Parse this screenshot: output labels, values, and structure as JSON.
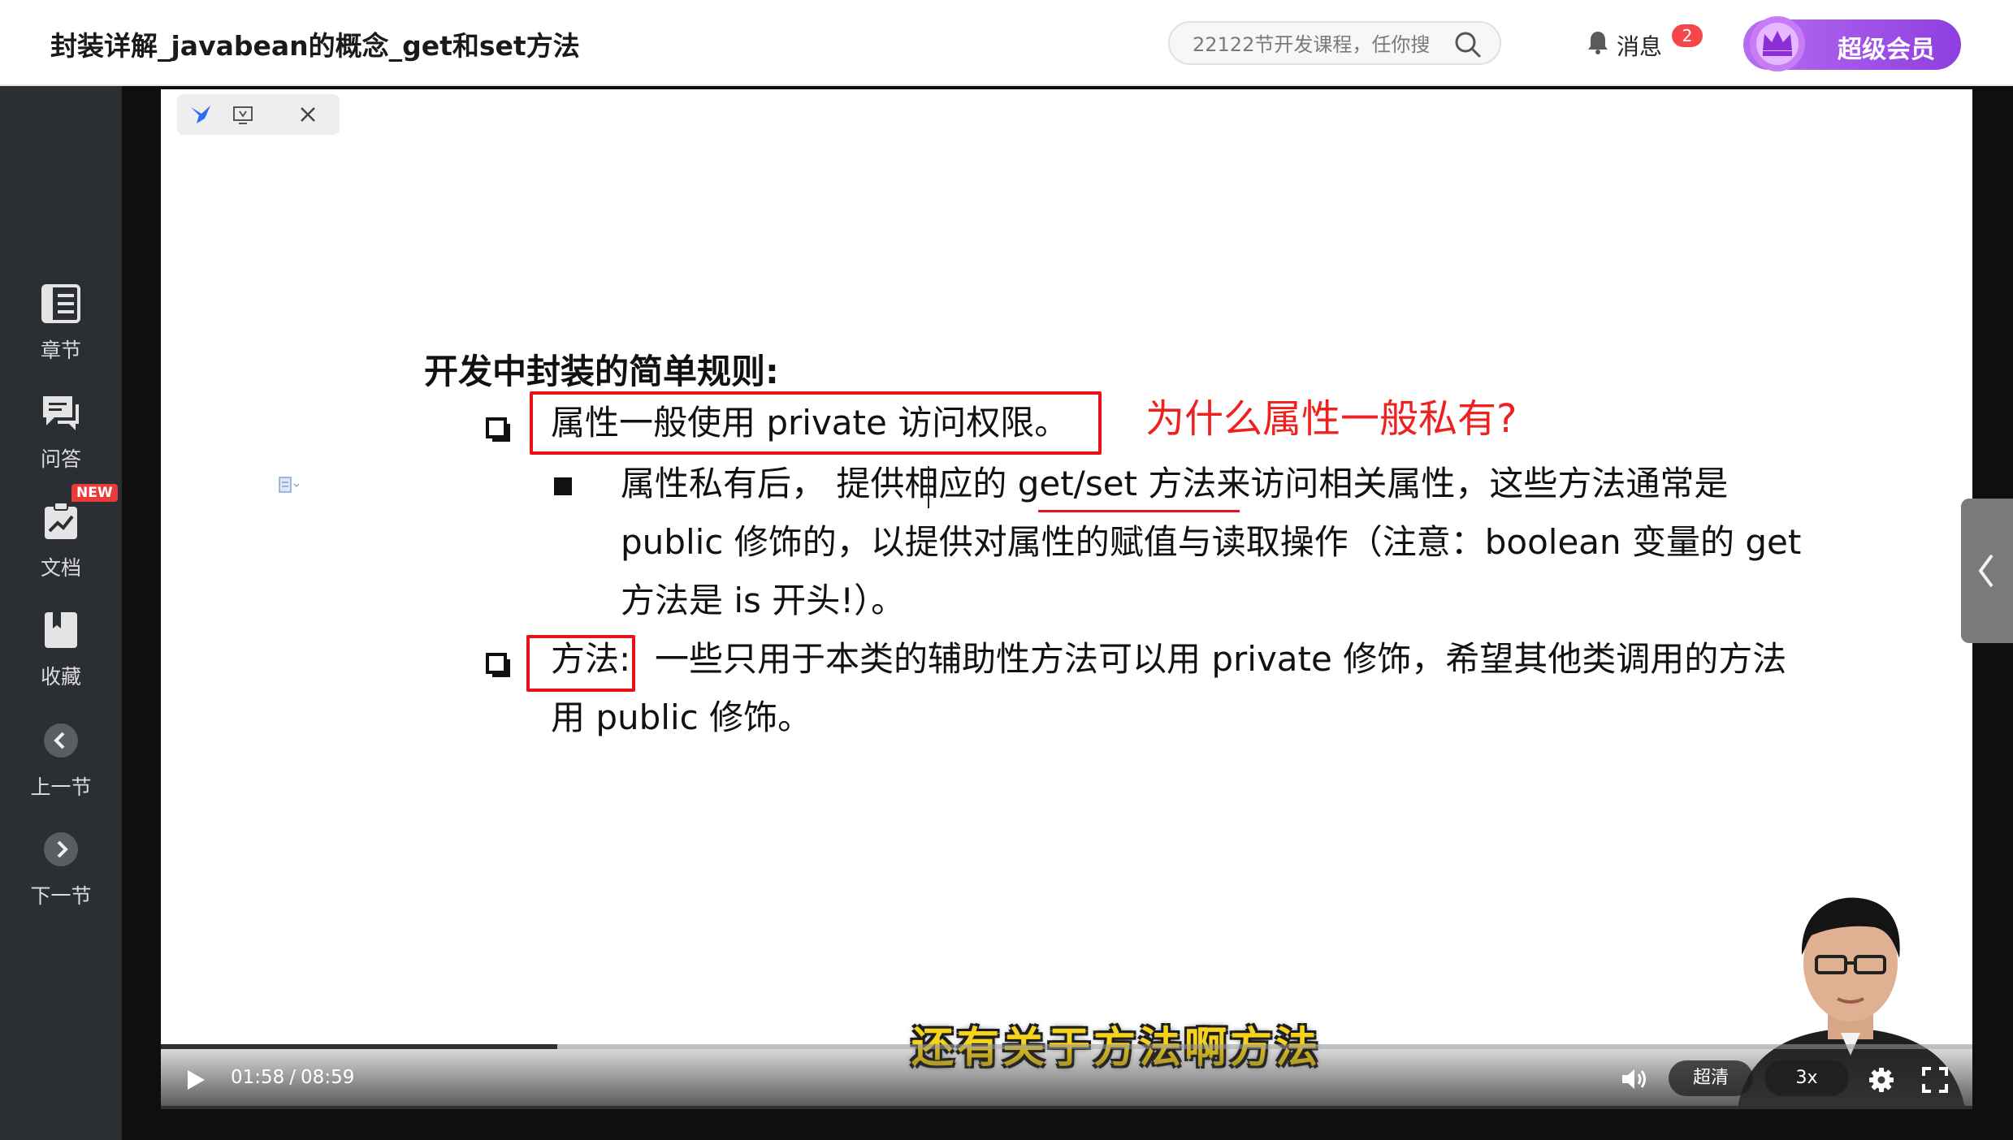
{
  "header": {
    "title": "封装详解_javabean的概念_get和set方法",
    "search_placeholder": "22122节开发课程，任你搜",
    "messages_label": "消息",
    "messages_count": "2",
    "vip_label": "超级会员"
  },
  "sidebar": {
    "items": [
      {
        "label": "章节",
        "icon": "chapters-icon"
      },
      {
        "label": "问答",
        "icon": "qa-icon"
      },
      {
        "label": "文档",
        "icon": "document-icon",
        "badge": "NEW"
      },
      {
        "label": "收藏",
        "icon": "bookmark-icon"
      },
      {
        "label": "上一节",
        "icon": "chevron-left-icon"
      },
      {
        "label": "下一节",
        "icon": "chevron-right-icon"
      }
    ]
  },
  "slide": {
    "heading": "开发中封装的简单规则:",
    "bullet1": "属性一般使用 private 访问权限。",
    "note": "为什么属性一般私有?",
    "sub1_line1": "属性私有后， 提供相应的 get/set 方法来访问相关属性，这些方法通常是",
    "sub1_line2": "public 修饰的，以提供对属性的赋值与读取操作（注意：boolean 变量的 get",
    "sub1_line3": "方法是 is 开头!）。",
    "bullet2_label": "方法:",
    "bullet2_rest": "一些只用于本类的辅助性方法可以用 private 修饰，希望其他类调用的方法",
    "bullet2_line2": "用 public 修饰。"
  },
  "player": {
    "subtitle": "还有关于方法啊方法",
    "current_time": "01:58",
    "time_separator": "/",
    "duration": "08:59",
    "progress": 0.219,
    "quality": "超清",
    "speed": "3x"
  },
  "colors": {
    "accent_red": "#e8121a",
    "vip_purple": "#9b4be6",
    "subtitle_yellow": "#f5d21b",
    "sidebar_bg": "#2b2e33"
  }
}
